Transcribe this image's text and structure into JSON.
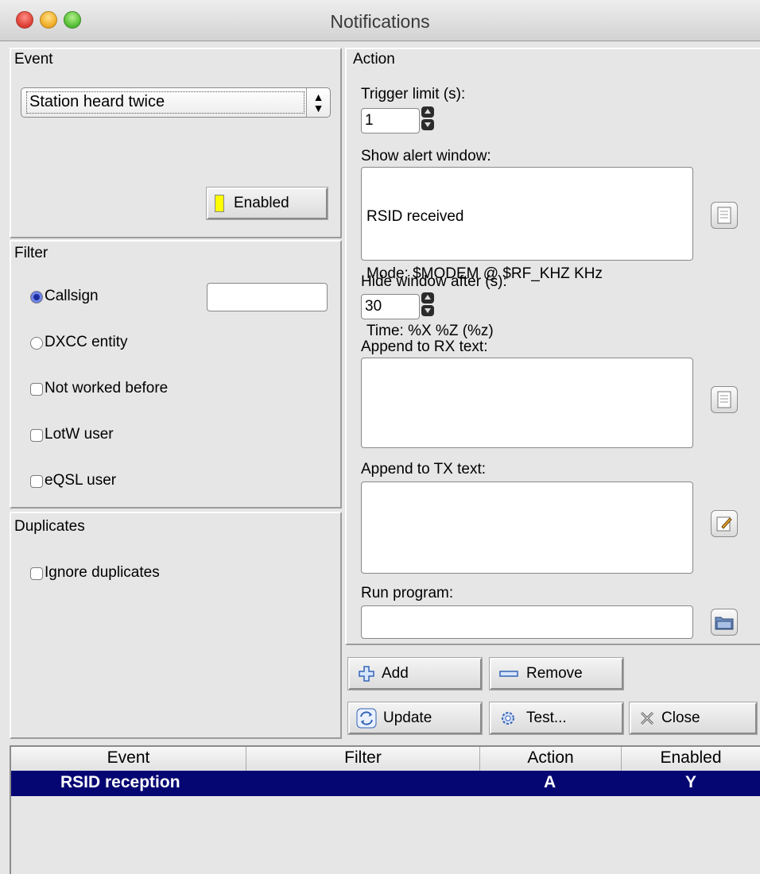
{
  "window": {
    "title": "Notifications"
  },
  "event": {
    "group_label": "Event",
    "selected_event": "Station heard twice",
    "enabled_label": "Enabled"
  },
  "filter": {
    "group_label": "Filter",
    "callsign_label": "Callsign",
    "callsign_value": "",
    "dxcc_label": "DXCC entity",
    "not_worked_label": "Not worked before",
    "lotw_label": "LotW user",
    "eqsl_label": "eQSL user"
  },
  "duplicates": {
    "group_label": "Duplicates",
    "ignore_label": "Ignore duplicates"
  },
  "action": {
    "group_label": "Action",
    "trigger_limit_label": "Trigger limit (s):",
    "trigger_limit_value": "1",
    "show_alert_label": "Show alert window:",
    "alert_text_lines": [
      "RSID received",
      "Mode: $MODEM @ $RF_KHZ KHz",
      "Time: %X %Z (%z)"
    ],
    "hide_after_label": "Hide window after (s):",
    "hide_after_value": "30",
    "append_rx_label": "Append to RX text:",
    "append_tx_label": "Append to TX text:",
    "run_program_label": "Run program:",
    "run_program_value": ""
  },
  "buttons": {
    "add": "Add",
    "remove": "Remove",
    "update": "Update",
    "test": "Test...",
    "close": "Close"
  },
  "table": {
    "columns": [
      "Event",
      "Filter",
      "Action",
      "Enabled"
    ],
    "rows": [
      {
        "event": "RSID reception",
        "filter": "",
        "action": "A",
        "enabled": "Y",
        "selected": true
      }
    ]
  },
  "colors": {
    "selection": "#060673",
    "enabled_indicator": "#ffff00"
  },
  "icons": {
    "add": "plus-icon",
    "remove": "minus-icon",
    "update": "refresh-icon",
    "test": "gear-icon",
    "close": "x-icon",
    "alert_edit": "document-icon",
    "rx_edit": "document-icon",
    "tx_edit": "edit-icon",
    "run_browse": "folder-icon"
  }
}
